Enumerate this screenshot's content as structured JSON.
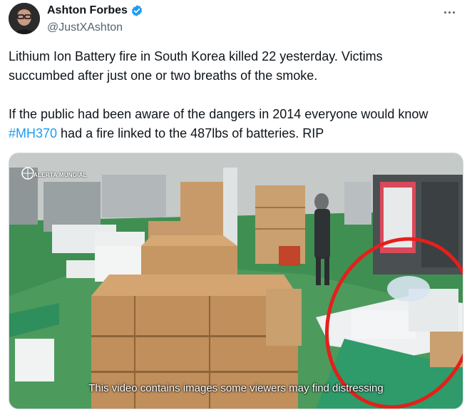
{
  "author": {
    "name": "Ashton Forbes",
    "handle": "@JustXAshton"
  },
  "post": {
    "text_before": "Lithium Ion Battery fire in South Korea killed 22 yesterday. Victims succumbed after just one or two breaths of the smoke.\n\nIf the public had been aware of the dangers in 2014 everyone would know ",
    "hashtag": "#MH370",
    "text_after": " had a fire linked to the 487lbs of batteries. RIP"
  },
  "media": {
    "watermark": "ALERTA MUNDIAL",
    "caption": "This video contains images some viewers may find distressing"
  },
  "colors": {
    "accent": "#1d9bf0",
    "highlight_circle": "#e3201b"
  },
  "icons": {
    "verified": "verified-badge-icon",
    "more": "more-options-icon"
  }
}
